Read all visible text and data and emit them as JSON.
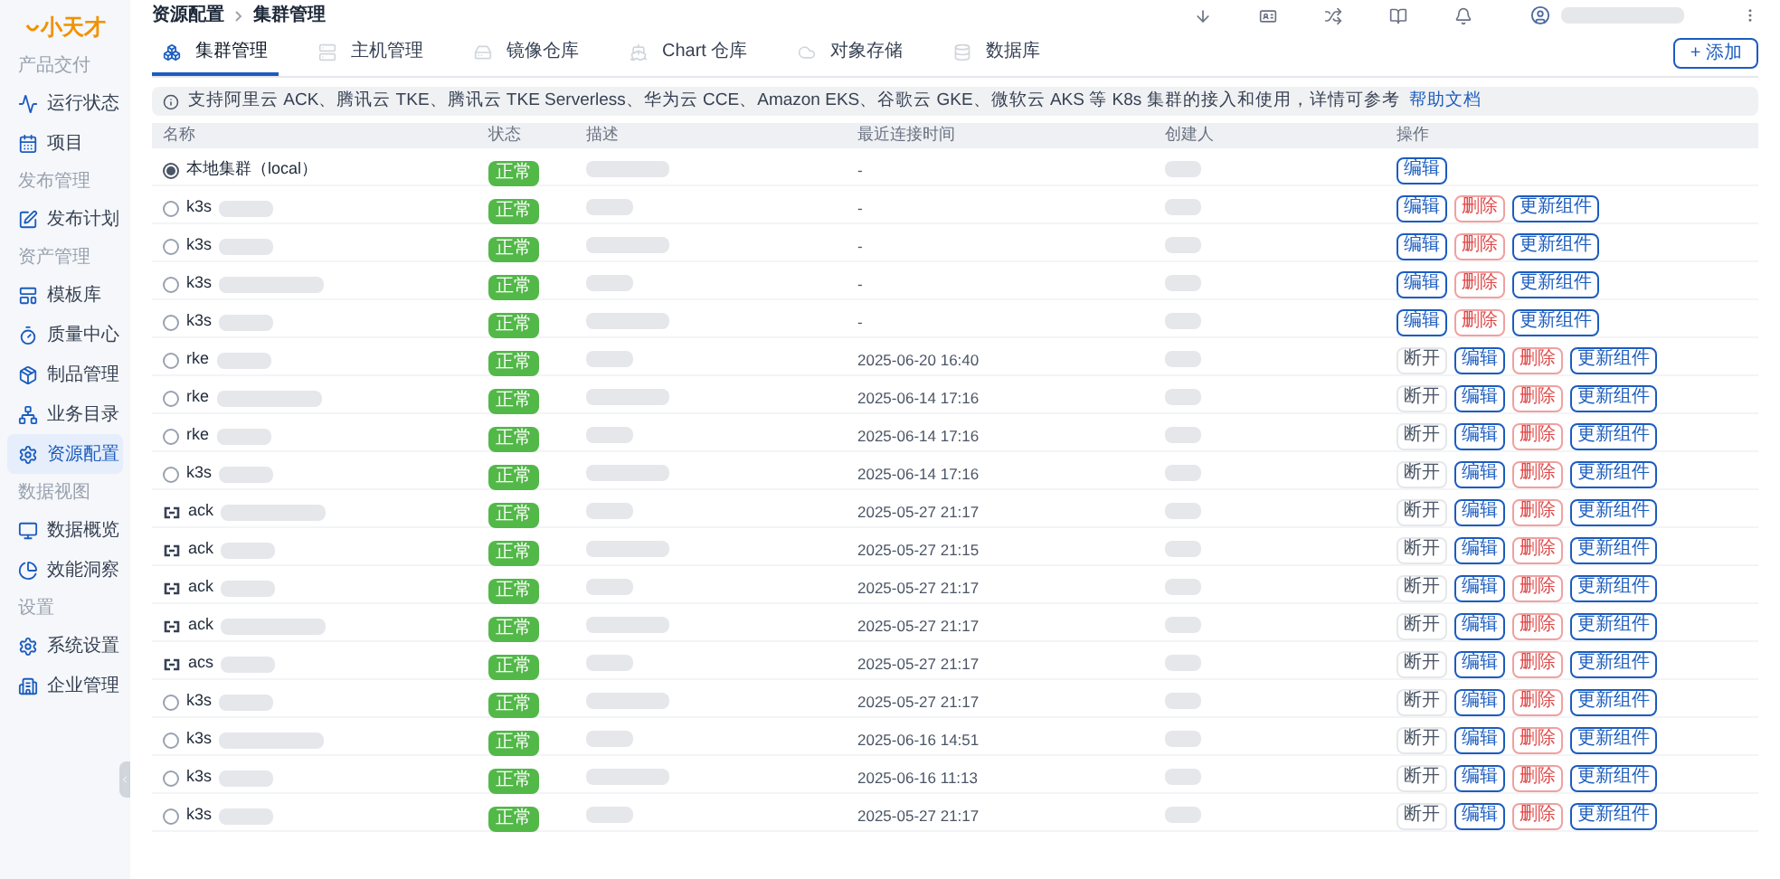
{
  "logo": {
    "text": "小天才"
  },
  "sidebar": [
    {
      "title": "产品交付",
      "items": [
        {
          "label": "运行状态",
          "selected": false
        },
        {
          "label": "项目",
          "selected": false
        }
      ]
    },
    {
      "title": "发布管理",
      "items": [
        {
          "label": "发布计划",
          "selected": false
        }
      ]
    },
    {
      "title": "资产管理",
      "items": [
        {
          "label": "模板库",
          "selected": false
        },
        {
          "label": "质量中心",
          "selected": false
        },
        {
          "label": "制品管理",
          "selected": false
        },
        {
          "label": "业务目录",
          "selected": false
        },
        {
          "label": "资源配置",
          "selected": true
        }
      ]
    },
    {
      "title": "数据视图",
      "items": [
        {
          "label": "数据概览",
          "selected": false
        },
        {
          "label": "效能洞察",
          "selected": false
        }
      ]
    },
    {
      "title": "设置",
      "items": [
        {
          "label": "系统设置",
          "selected": false
        },
        {
          "label": "企业管理",
          "selected": false
        }
      ]
    }
  ],
  "breadcrumb": [
    "资源配置",
    "集群管理"
  ],
  "tabs": [
    {
      "label": "集群管理",
      "selected": true
    },
    {
      "label": "主机管理",
      "selected": false
    },
    {
      "label": "镜像仓库",
      "selected": false
    },
    {
      "label": "Chart 仓库",
      "selected": false
    },
    {
      "label": "对象存储",
      "selected": false
    },
    {
      "label": "数据库",
      "selected": false
    }
  ],
  "add_button": "+ 添加",
  "alert": {
    "text": "支持阿里云 ACK、腾讯云 TKE、腾讯云 TKE Serverless、华为云 CCE、Amazon EKS、谷歌云 GKE、微软云 AKS 等 K8s 集群的接入和使用，详情可参考",
    "link": "帮助文档"
  },
  "table": {
    "columns": [
      "名称",
      "状态",
      "描述",
      "最近连接时间",
      "创建人",
      "操作"
    ],
    "rows": [
      {
        "name": "本地集群（local）",
        "kind": "radio",
        "selected": true,
        "status": "正常",
        "time": "-",
        "actions": [
          {
            "label": "编辑",
            "kind": "edit"
          }
        ]
      },
      {
        "name": "k3s",
        "kind": "radio",
        "selected": false,
        "status": "正常",
        "time": "-",
        "actions": [
          {
            "label": "编辑",
            "kind": "edit"
          },
          {
            "label": "删除",
            "kind": "delete"
          },
          {
            "label": "更新组件",
            "kind": "update"
          }
        ]
      },
      {
        "name": "k3s",
        "kind": "radio",
        "selected": false,
        "status": "正常",
        "time": "-",
        "actions": [
          {
            "label": "编辑",
            "kind": "edit"
          },
          {
            "label": "删除",
            "kind": "delete"
          },
          {
            "label": "更新组件",
            "kind": "update"
          }
        ]
      },
      {
        "name": "k3s",
        "kind": "radio",
        "selected": false,
        "status": "正常",
        "time": "-",
        "actions": [
          {
            "label": "编辑",
            "kind": "edit"
          },
          {
            "label": "删除",
            "kind": "delete"
          },
          {
            "label": "更新组件",
            "kind": "update"
          }
        ]
      },
      {
        "name": "k3s",
        "kind": "radio",
        "selected": false,
        "status": "正常",
        "time": "-",
        "actions": [
          {
            "label": "编辑",
            "kind": "edit"
          },
          {
            "label": "删除",
            "kind": "delete"
          },
          {
            "label": "更新组件",
            "kind": "update"
          }
        ]
      },
      {
        "name": "rke",
        "kind": "radio",
        "selected": false,
        "status": "正常",
        "time": "2025-06-20 16:40",
        "actions": [
          {
            "label": "断开",
            "kind": "disconnect"
          },
          {
            "label": "编辑",
            "kind": "edit"
          },
          {
            "label": "删除",
            "kind": "delete"
          },
          {
            "label": "更新组件",
            "kind": "update"
          }
        ]
      },
      {
        "name": "rke",
        "kind": "radio",
        "selected": false,
        "status": "正常",
        "time": "2025-06-14 17:16",
        "actions": [
          {
            "label": "断开",
            "kind": "disconnect"
          },
          {
            "label": "编辑",
            "kind": "edit"
          },
          {
            "label": "删除",
            "kind": "delete"
          },
          {
            "label": "更新组件",
            "kind": "update"
          }
        ]
      },
      {
        "name": "rke",
        "kind": "radio",
        "selected": false,
        "status": "正常",
        "time": "2025-06-14 17:16",
        "actions": [
          {
            "label": "断开",
            "kind": "disconnect"
          },
          {
            "label": "编辑",
            "kind": "edit"
          },
          {
            "label": "删除",
            "kind": "delete"
          },
          {
            "label": "更新组件",
            "kind": "update"
          }
        ]
      },
      {
        "name": "k3s",
        "kind": "radio",
        "selected": false,
        "status": "正常",
        "time": "2025-06-14 17:16",
        "actions": [
          {
            "label": "断开",
            "kind": "disconnect"
          },
          {
            "label": "编辑",
            "kind": "edit"
          },
          {
            "label": "删除",
            "kind": "delete"
          },
          {
            "label": "更新组件",
            "kind": "update"
          }
        ]
      },
      {
        "name": "ack",
        "kind": "cloud",
        "selected": false,
        "status": "正常",
        "time": "2025-05-27 21:17",
        "actions": [
          {
            "label": "断开",
            "kind": "disconnect"
          },
          {
            "label": "编辑",
            "kind": "edit"
          },
          {
            "label": "删除",
            "kind": "delete"
          },
          {
            "label": "更新组件",
            "kind": "update"
          }
        ]
      },
      {
        "name": "ack",
        "kind": "cloud",
        "selected": false,
        "status": "正常",
        "time": "2025-05-27 21:15",
        "actions": [
          {
            "label": "断开",
            "kind": "disconnect"
          },
          {
            "label": "编辑",
            "kind": "edit"
          },
          {
            "label": "删除",
            "kind": "delete"
          },
          {
            "label": "更新组件",
            "kind": "update"
          }
        ]
      },
      {
        "name": "ack",
        "kind": "cloud",
        "selected": false,
        "status": "正常",
        "time": "2025-05-27 21:17",
        "actions": [
          {
            "label": "断开",
            "kind": "disconnect"
          },
          {
            "label": "编辑",
            "kind": "edit"
          },
          {
            "label": "删除",
            "kind": "delete"
          },
          {
            "label": "更新组件",
            "kind": "update"
          }
        ]
      },
      {
        "name": "ack",
        "kind": "cloud",
        "selected": false,
        "status": "正常",
        "time": "2025-05-27 21:17",
        "actions": [
          {
            "label": "断开",
            "kind": "disconnect"
          },
          {
            "label": "编辑",
            "kind": "edit"
          },
          {
            "label": "删除",
            "kind": "delete"
          },
          {
            "label": "更新组件",
            "kind": "update"
          }
        ]
      },
      {
        "name": "acs",
        "kind": "cloud",
        "selected": false,
        "status": "正常",
        "time": "2025-05-27 21:17",
        "actions": [
          {
            "label": "断开",
            "kind": "disconnect"
          },
          {
            "label": "编辑",
            "kind": "edit"
          },
          {
            "label": "删除",
            "kind": "delete"
          },
          {
            "label": "更新组件",
            "kind": "update"
          }
        ]
      },
      {
        "name": "k3s",
        "kind": "radio",
        "selected": false,
        "status": "正常",
        "time": "2025-05-27 21:17",
        "actions": [
          {
            "label": "断开",
            "kind": "disconnect"
          },
          {
            "label": "编辑",
            "kind": "edit"
          },
          {
            "label": "删除",
            "kind": "delete"
          },
          {
            "label": "更新组件",
            "kind": "update"
          }
        ]
      },
      {
        "name": "k3s",
        "kind": "radio",
        "selected": false,
        "status": "正常",
        "time": "2025-06-16 14:51",
        "actions": [
          {
            "label": "断开",
            "kind": "disconnect"
          },
          {
            "label": "编辑",
            "kind": "edit"
          },
          {
            "label": "删除",
            "kind": "delete"
          },
          {
            "label": "更新组件",
            "kind": "update"
          }
        ]
      },
      {
        "name": "k3s",
        "kind": "radio",
        "selected": false,
        "status": "正常",
        "time": "2025-06-16 11:13",
        "actions": [
          {
            "label": "断开",
            "kind": "disconnect"
          },
          {
            "label": "编辑",
            "kind": "edit"
          },
          {
            "label": "删除",
            "kind": "delete"
          },
          {
            "label": "更新组件",
            "kind": "update"
          }
        ]
      },
      {
        "name": "k3s",
        "kind": "radio",
        "selected": false,
        "status": "正常",
        "time": "2025-05-27 21:17",
        "actions": [
          {
            "label": "断开",
            "kind": "disconnect"
          },
          {
            "label": "编辑",
            "kind": "edit"
          },
          {
            "label": "删除",
            "kind": "delete"
          },
          {
            "label": "更新组件",
            "kind": "update"
          }
        ]
      }
    ]
  }
}
